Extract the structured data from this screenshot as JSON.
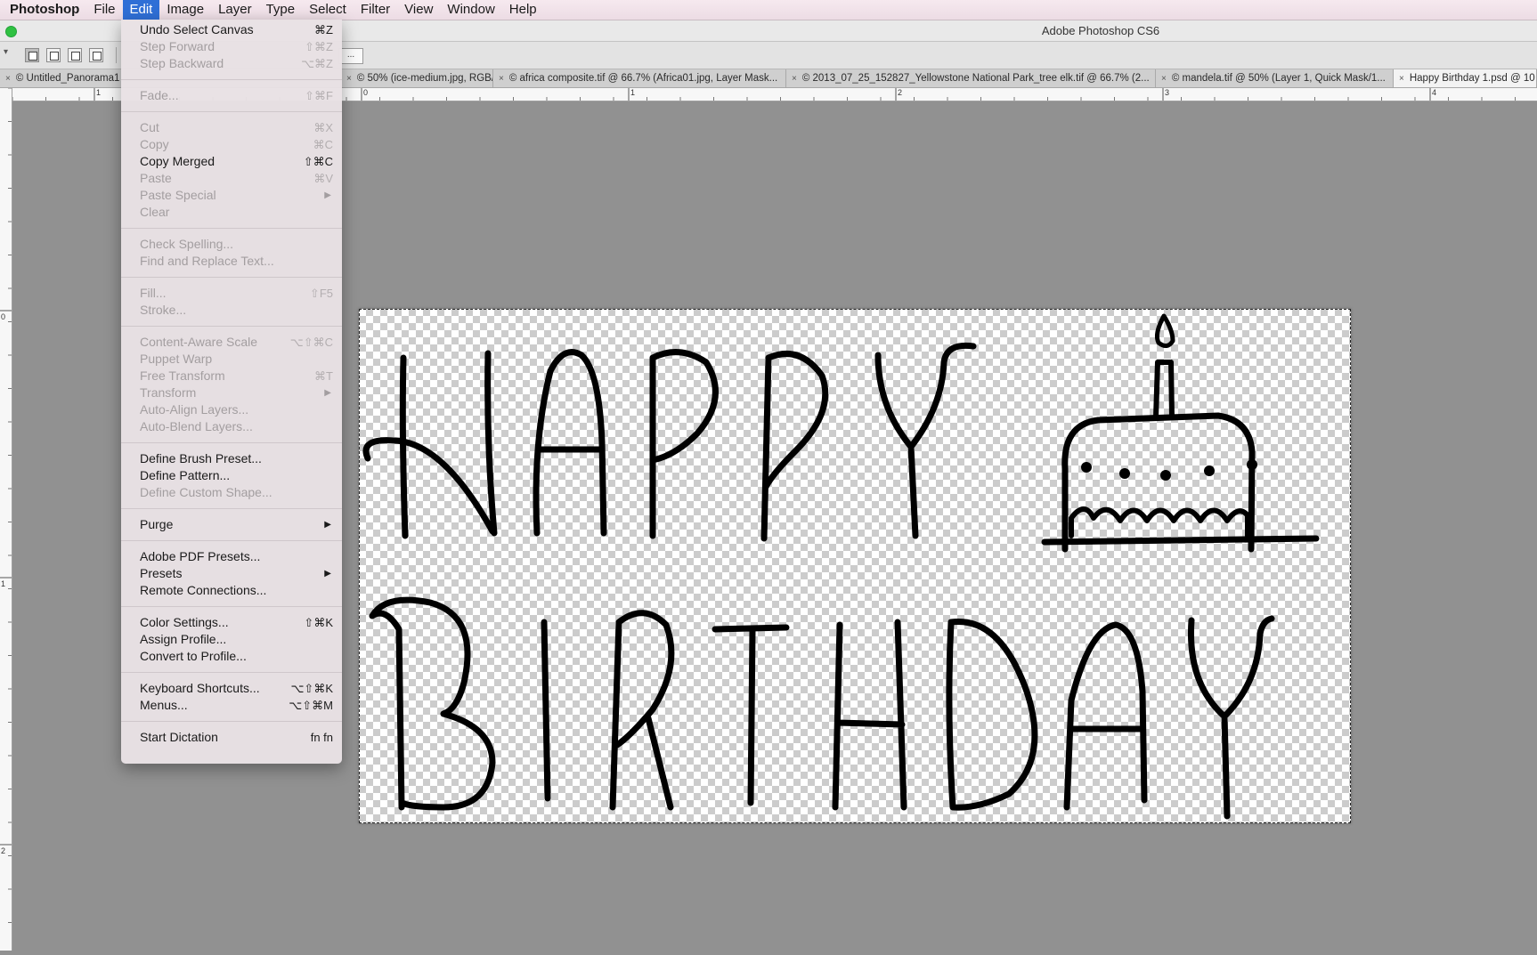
{
  "menubar": {
    "app": "Photoshop",
    "items": [
      "File",
      "Edit",
      "Image",
      "Layer",
      "Type",
      "Select",
      "Filter",
      "View",
      "Window",
      "Help"
    ],
    "active": "Edit"
  },
  "window": {
    "title": "Adobe Photoshop CS6"
  },
  "tabs": [
    {
      "label": "Untitled_Panorama1",
      "active": false
    },
    {
      "label": "50% (ice-medium.jpg, RGB/...",
      "active": false
    },
    {
      "label": "africa composite.tif @ 66.7% (Africa01.jpg, Layer Mask...",
      "active": false
    },
    {
      "label": "2013_07_25_152827_Yellowstone National Park_tree elk.tif @ 66.7% (2...",
      "active": false
    },
    {
      "label": "mandela.tif @ 50% (Layer 1, Quick Mask/1...",
      "active": false
    },
    {
      "label": "Happy Birthday 1.psd @ 10",
      "active": true
    }
  ],
  "glyphs": {
    "close": "×",
    "copyright": "©"
  },
  "ruler": {
    "h_labels": [
      "1",
      "0",
      "1",
      "2",
      "3",
      "4"
    ],
    "v_labels": [
      "0",
      "1",
      "2"
    ]
  },
  "edit_menu": {
    "groups": [
      [
        {
          "label": "Undo Select Canvas",
          "shortcut": "⌘Z",
          "enabled": true
        },
        {
          "label": "Step Forward",
          "shortcut": "⇧⌘Z",
          "enabled": false
        },
        {
          "label": "Step Backward",
          "shortcut": "⌥⌘Z",
          "enabled": false
        }
      ],
      [
        {
          "label": "Fade...",
          "shortcut": "⇧⌘F",
          "enabled": false
        }
      ],
      [
        {
          "label": "Cut",
          "shortcut": "⌘X",
          "enabled": false
        },
        {
          "label": "Copy",
          "shortcut": "⌘C",
          "enabled": false
        },
        {
          "label": "Copy Merged",
          "shortcut": "⇧⌘C",
          "enabled": true
        },
        {
          "label": "Paste",
          "shortcut": "⌘V",
          "enabled": false
        },
        {
          "label": "Paste Special",
          "shortcut": "",
          "enabled": false,
          "submenu": true
        },
        {
          "label": "Clear",
          "shortcut": "",
          "enabled": false
        }
      ],
      [
        {
          "label": "Check Spelling...",
          "shortcut": "",
          "enabled": false
        },
        {
          "label": "Find and Replace Text...",
          "shortcut": "",
          "enabled": false
        }
      ],
      [
        {
          "label": "Fill...",
          "shortcut": "⇧F5",
          "enabled": false
        },
        {
          "label": "Stroke...",
          "shortcut": "",
          "enabled": false
        }
      ],
      [
        {
          "label": "Content-Aware Scale",
          "shortcut": "⌥⇧⌘C",
          "enabled": false
        },
        {
          "label": "Puppet Warp",
          "shortcut": "",
          "enabled": false
        },
        {
          "label": "Free Transform",
          "shortcut": "⌘T",
          "enabled": false
        },
        {
          "label": "Transform",
          "shortcut": "",
          "enabled": false,
          "submenu": true
        },
        {
          "label": "Auto-Align Layers...",
          "shortcut": "",
          "enabled": false
        },
        {
          "label": "Auto-Blend Layers...",
          "shortcut": "",
          "enabled": false
        }
      ],
      [
        {
          "label": "Define Brush Preset...",
          "shortcut": "",
          "enabled": true
        },
        {
          "label": "Define Pattern...",
          "shortcut": "",
          "enabled": true
        },
        {
          "label": "Define Custom Shape...",
          "shortcut": "",
          "enabled": false
        }
      ],
      [
        {
          "label": "Purge",
          "shortcut": "",
          "enabled": true,
          "submenu": true
        }
      ],
      [
        {
          "label": "Adobe PDF Presets...",
          "shortcut": "",
          "enabled": true
        },
        {
          "label": "Presets",
          "shortcut": "",
          "enabled": true,
          "submenu": true
        },
        {
          "label": "Remote Connections...",
          "shortcut": "",
          "enabled": true
        }
      ],
      [
        {
          "label": "Color Settings...",
          "shortcut": "⇧⌘K",
          "enabled": true
        },
        {
          "label": "Assign Profile...",
          "shortcut": "",
          "enabled": true
        },
        {
          "label": "Convert to Profile...",
          "shortcut": "",
          "enabled": true
        }
      ],
      [
        {
          "label": "Keyboard Shortcuts...",
          "shortcut": "⌥⇧⌘K",
          "enabled": true
        },
        {
          "label": "Menus...",
          "shortcut": "⌥⇧⌘M",
          "enabled": true
        }
      ],
      [
        {
          "label": "Start Dictation",
          "shortcut": "fn fn",
          "enabled": true
        }
      ]
    ]
  },
  "canvas": {
    "artwork": "happy-birthday-hand-lettering-with-cake",
    "stroke_color": "#000000"
  },
  "icons": {
    "traffic_light": "green-zoom-dot",
    "submenu": "▶",
    "tool_modes": [
      "new-selection-icon",
      "add-to-selection-icon",
      "subtract-from-selection-icon",
      "intersect-selection-icon"
    ]
  },
  "colors": {
    "menu_highlight": "#2f6fd6",
    "workspace": "#919191"
  }
}
